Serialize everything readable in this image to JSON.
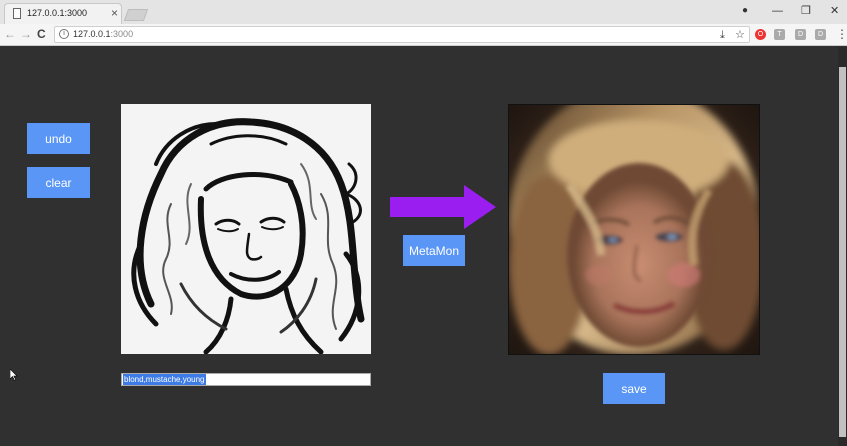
{
  "browser": {
    "tab_title": "127.0.0.1:3000",
    "tab_close": "×",
    "url_host": "127.0.0.1",
    "url_port": ":3000",
    "back": "←",
    "forward": "→",
    "reload": "C",
    "info": "i",
    "download": "⤓",
    "star": "☆",
    "account": "●",
    "minimize": "—",
    "restore": "❐",
    "close": "✕",
    "menu": "⋮",
    "extensions": [
      "O",
      "T",
      "D",
      "D"
    ]
  },
  "page": {
    "undo_label": "undo",
    "clear_label": "clear",
    "generate_label": "MetaMon",
    "save_label": "save",
    "attributes_value": "blond,mustache,young"
  },
  "colors": {
    "button": "#5a96f5",
    "arrow": "#9a1ef0",
    "background": "#303030"
  }
}
